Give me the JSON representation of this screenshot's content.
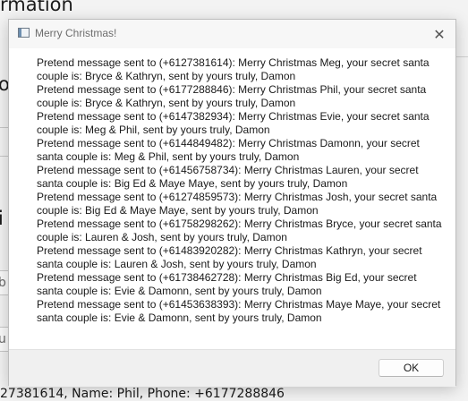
{
  "background": {
    "title_fragment": "rmation",
    "fragment_1": "o",
    "fragment_2": "i",
    "input_fragment_1": "b",
    "input_fragment_2": "u",
    "bottom_text": "27381614, Name: Phil, Phone: +6177288846"
  },
  "dialog": {
    "title": "Merry Christmas!",
    "icon": "app-window-icon",
    "close_glyph": "✕",
    "messages": [
      "Pretend message sent to (+6127381614): Merry Christmas Meg, your secret santa couple is: Bryce & Kathryn, sent by yours truly, Damon",
      "Pretend message sent to (+6177288846): Merry Christmas Phil, your secret santa couple is: Bryce & Kathryn, sent by yours truly, Damon",
      "Pretend message sent to (+6147382934): Merry Christmas Evie, your secret santa couple is: Meg & Phil, sent by yours truly, Damon",
      "Pretend message sent to (+6144849482): Merry Christmas Damonn, your secret santa couple is: Meg & Phil, sent by yours truly, Damon",
      "Pretend message sent to (+61456758734): Merry Christmas Lauren, your secret santa couple is: Big Ed & Maye Maye, sent by yours truly, Damon",
      "Pretend message sent to (+61274859573): Merry Christmas Josh, your secret santa couple is: Big Ed & Maye Maye, sent by yours truly, Damon",
      "Pretend message sent to (+61758298262): Merry Christmas Bryce, your secret santa couple is: Lauren & Josh, sent by yours truly, Damon",
      "Pretend message sent to (+61483920282): Merry Christmas Kathryn, your secret santa couple is: Lauren & Josh, sent by yours truly, Damon",
      "Pretend message sent to (+61738462728): Merry Christmas Big Ed, your secret santa couple is: Evie & Damonn, sent by yours truly, Damon",
      "Pretend message sent to (+61453638393): Merry Christmas Maye Maye, your secret santa couple is: Evie & Damonn, sent by yours truly, Damon"
    ],
    "ok_label": "OK"
  }
}
